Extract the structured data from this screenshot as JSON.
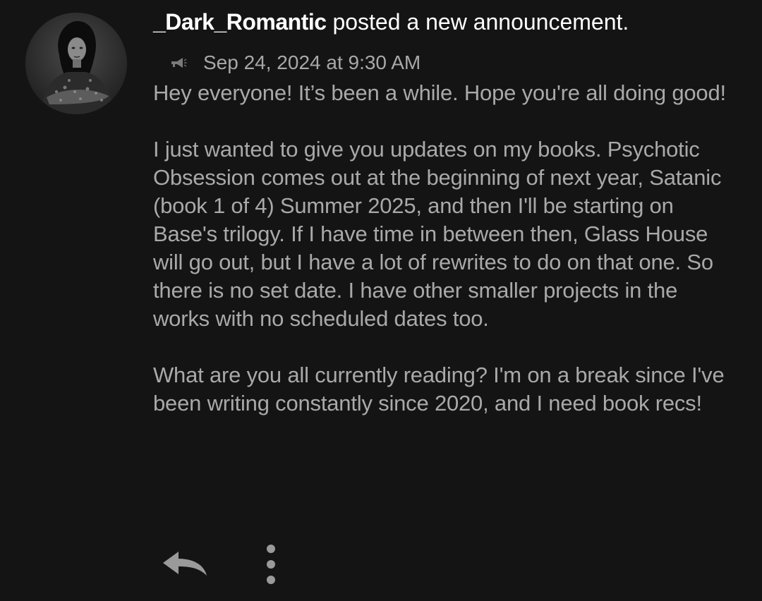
{
  "post": {
    "username": "_Dark_Romantic",
    "action_text": " posted a new announcement.",
    "timestamp": "Sep 24, 2024 at 9:30 AM",
    "icon": "megaphone-icon",
    "paragraphs": [
      "Hey everyone! It’s been a while. Hope you're all doing good!",
      "I just wanted to give you updates on my books. Psychotic Obsession comes out at the beginning of next year, Satanic (book 1 of 4) Summer 2025, and then I'll be starting on Base's trilogy. If I have time in between then, Glass House will go out, but I have a lot of rewrites to do on that one. So there is no set date. I have other smaller projects in the works with no scheduled dates too.",
      "What are you all currently reading? I'm on a break since I've been writing constantly since 2020, and I need book recs!"
    ]
  },
  "actions": {
    "reply_icon": "reply-arrow-icon",
    "more_icon": "more-vertical-icon"
  },
  "colors": {
    "background": "#141414",
    "username": "#ffffff",
    "body_text": "#a9a9a9",
    "icon_gray": "#9a9a9a"
  }
}
